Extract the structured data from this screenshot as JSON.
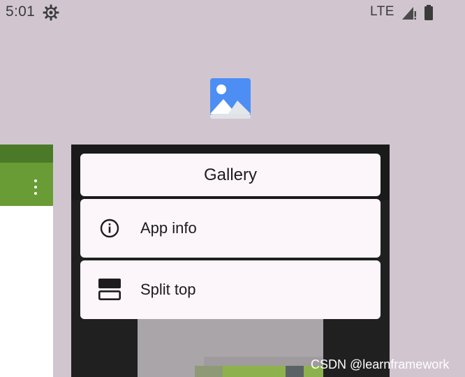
{
  "status_bar": {
    "time": "5:01",
    "network": "LTE",
    "icons": [
      "settings-gear-icon",
      "signal-icon",
      "battery-icon"
    ]
  },
  "recents": {
    "focused_app": {
      "name": "Gallery",
      "icon": "gallery-photo-icon"
    },
    "menu": {
      "title": "Gallery",
      "items": [
        {
          "label": "App info",
          "icon": "info-icon"
        },
        {
          "label": "Split top",
          "icon": "split-top-icon"
        }
      ]
    },
    "left_task": {
      "icons": [
        "overflow-menu-icon"
      ]
    }
  },
  "watermark": "CSDN @learnframework",
  "colors": {
    "background": "#d1c6d0",
    "menu_surface": "#fcf6fa",
    "left_app_toolbar": "#6a9c35",
    "left_app_statusbar": "#4a7a28",
    "gallery_icon_blue": "#4d8ef5"
  }
}
